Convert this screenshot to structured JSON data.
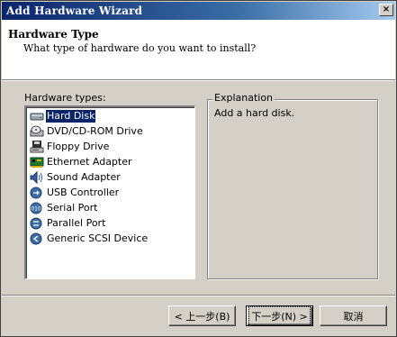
{
  "window": {
    "title": "Add Hardware Wizard",
    "close_glyph": "×"
  },
  "header": {
    "title": "Hardware Type",
    "subtitle": "What type of hardware do you want to install?"
  },
  "list": {
    "label": "Hardware types:",
    "selected_index": 0,
    "items": [
      {
        "label": "Hard Disk",
        "icon": "hard-disk-icon"
      },
      {
        "label": "DVD/CD-ROM Drive",
        "icon": "cdrom-drive-icon"
      },
      {
        "label": "Floppy Drive",
        "icon": "floppy-drive-icon"
      },
      {
        "label": "Ethernet Adapter",
        "icon": "ethernet-adapter-icon"
      },
      {
        "label": "Sound Adapter",
        "icon": "speaker-icon"
      },
      {
        "label": "USB Controller",
        "icon": "usb-icon"
      },
      {
        "label": "Serial Port",
        "icon": "serial-port-icon"
      },
      {
        "label": "Parallel Port",
        "icon": "parallel-port-icon"
      },
      {
        "label": "Generic SCSI Device",
        "icon": "scsi-device-icon"
      }
    ]
  },
  "explanation": {
    "legend": "Explanation",
    "text": "Add a hard disk."
  },
  "buttons": {
    "back": "< 上一步(B)",
    "next": "下一步(N) >",
    "cancel": "取消"
  },
  "colors": {
    "title_bar": "#0a246a",
    "selection": "#0a246a",
    "face": "#d4d0c8"
  }
}
